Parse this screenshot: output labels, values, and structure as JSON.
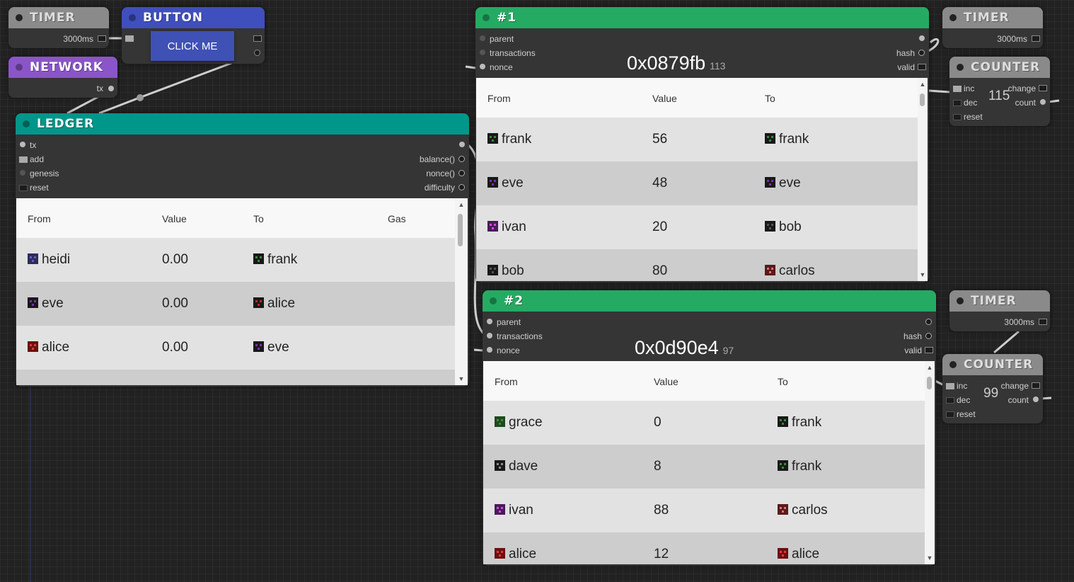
{
  "nodes": {
    "timer1": {
      "title": "TIMER",
      "interval": "3000ms"
    },
    "button": {
      "title": "BUTTON",
      "label": "CLICK ME"
    },
    "network": {
      "title": "NETWORK",
      "out": "tx"
    },
    "ledger": {
      "title": "LEDGER",
      "inputs": [
        "tx",
        "add",
        "genesis",
        "reset"
      ],
      "outputs": [
        "balance()",
        "nonce()",
        "difficulty"
      ],
      "columns": [
        "From",
        "Value",
        "To",
        "Gas"
      ],
      "rows": [
        {
          "from": "heidi",
          "value": "0.00",
          "to": "frank"
        },
        {
          "from": "eve",
          "value": "0.00",
          "to": "alice"
        },
        {
          "from": "alice",
          "value": "0.00",
          "to": "eve"
        }
      ]
    },
    "block1": {
      "title": "#1",
      "inputs": [
        "parent",
        "transactions",
        "nonce"
      ],
      "outputs": [
        "hash",
        "valid"
      ],
      "hash": "0x0879fb",
      "nonce": "113",
      "columns": [
        "From",
        "Value",
        "To"
      ],
      "rows": [
        {
          "from": "frank",
          "value": "56",
          "to": "frank"
        },
        {
          "from": "eve",
          "value": "48",
          "to": "eve"
        },
        {
          "from": "ivan",
          "value": "20",
          "to": "bob"
        },
        {
          "from": "bob",
          "value": "80",
          "to": "carlos"
        }
      ]
    },
    "block2": {
      "title": "#2",
      "inputs": [
        "parent",
        "transactions",
        "nonce"
      ],
      "outputs": [
        "hash",
        "valid"
      ],
      "hash": "0x0d90e4",
      "nonce": "97",
      "columns": [
        "From",
        "Value",
        "To"
      ],
      "rows": [
        {
          "from": "grace",
          "value": "0",
          "to": "frank"
        },
        {
          "from": "dave",
          "value": "8",
          "to": "frank"
        },
        {
          "from": "ivan",
          "value": "88",
          "to": "carlos"
        },
        {
          "from": "alice",
          "value": "12",
          "to": "alice"
        }
      ]
    },
    "timer2": {
      "title": "TIMER",
      "interval": "3000ms"
    },
    "counter1": {
      "title": "COUNTER",
      "inputs": [
        "inc",
        "dec",
        "reset"
      ],
      "outputs": [
        "change",
        "count"
      ],
      "value": "115"
    },
    "timer3": {
      "title": "TIMER",
      "interval": "3000ms"
    },
    "counter2": {
      "title": "COUNTER",
      "inputs": [
        "inc",
        "dec",
        "reset"
      ],
      "outputs": [
        "change",
        "count"
      ],
      "value": "99"
    }
  },
  "colors": {
    "canvas": "#222222",
    "node_body": "#353535",
    "title_grey": "#8a8a8a",
    "title_blue": "#3f4fbd",
    "title_purple": "#8a55c9",
    "title_teal": "#00968a",
    "title_green": "#25aa63",
    "avatar": {
      "frank": "#3a8a3a",
      "eve": "#7a2fb0",
      "heidi": "#6a5acd",
      "alice": "#c62828",
      "ivan": "#b03ac8",
      "bob": "#444444",
      "carlos": "#c06060",
      "grace": "#3c8f3c",
      "dave": "#8c8c8c"
    }
  }
}
